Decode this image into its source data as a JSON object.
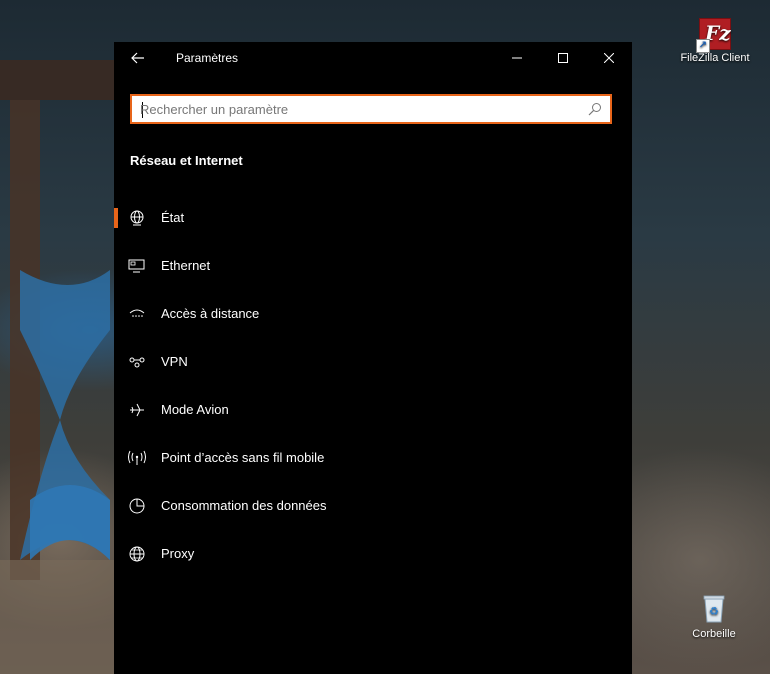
{
  "desktop": {
    "icons": [
      {
        "label": "FileZilla Client",
        "icon": "filezilla-icon"
      },
      {
        "label": "Corbeille",
        "icon": "recycle-bin-icon"
      }
    ]
  },
  "window": {
    "title": "Paramètres",
    "controls": [
      "back-arrow-icon",
      "minimize-icon",
      "maximize-icon",
      "close-icon"
    ],
    "search": {
      "placeholder": "Rechercher un paramètre",
      "value": ""
    },
    "section_title": "Réseau et Internet",
    "accent_color": "#e8651a",
    "nav_items": [
      {
        "label": "État",
        "icon": "globe-monitor-icon",
        "selected": true
      },
      {
        "label": "Ethernet",
        "icon": "ethernet-icon",
        "selected": false
      },
      {
        "label": "Accès à distance",
        "icon": "dialup-icon",
        "selected": false
      },
      {
        "label": "VPN",
        "icon": "vpn-icon",
        "selected": false
      },
      {
        "label": "Mode Avion",
        "icon": "airplane-icon",
        "selected": false
      },
      {
        "label": "Point d’accès sans fil mobile",
        "icon": "hotspot-icon",
        "selected": false
      },
      {
        "label": "Consommation des données",
        "icon": "data-usage-icon",
        "selected": false
      },
      {
        "label": "Proxy",
        "icon": "globe-icon",
        "selected": false
      }
    ]
  }
}
